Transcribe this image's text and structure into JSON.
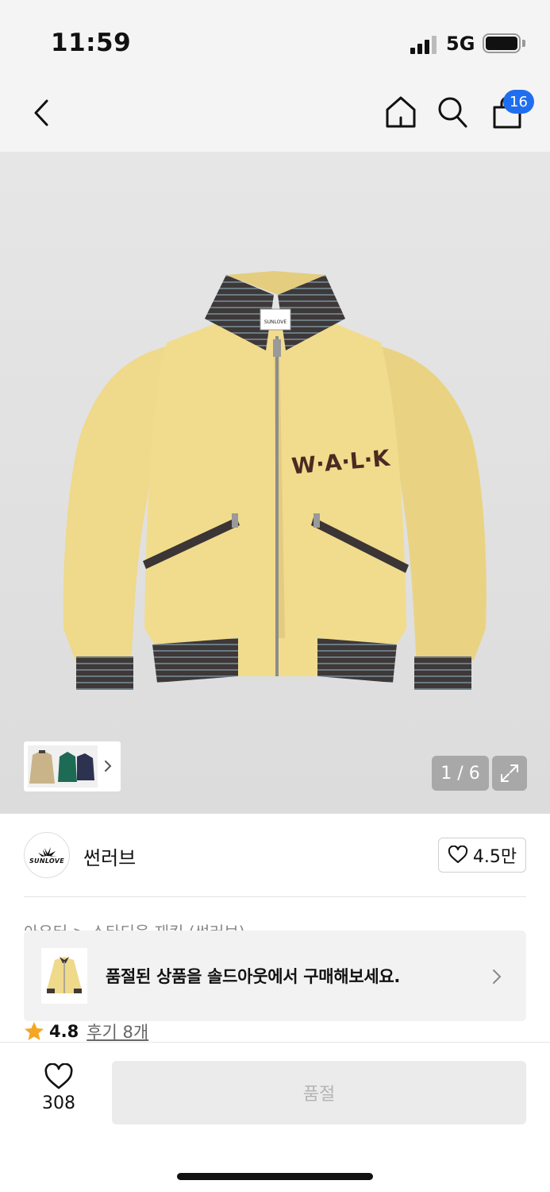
{
  "status_bar": {
    "time": "11:59",
    "network": "5G",
    "icons": [
      "signal-icon",
      "battery-icon"
    ]
  },
  "nav": {
    "icons": [
      "back-arrow-icon",
      "home-icon",
      "search-icon",
      "cart-icon"
    ],
    "cart_badge": "16"
  },
  "gallery": {
    "counter": "1 / 6",
    "icons": [
      "chevron-right-icon",
      "expand-icon"
    ],
    "jacket_text": "W·A·L·K",
    "label_text": "SUNLOVE"
  },
  "brand": {
    "logo_text": "SUNLOVE",
    "name": "썬러브",
    "like_count": "4.5만"
  },
  "breadcrumb": {
    "text": "아우터 > 스타디움 재킷 (썬러브)"
  },
  "soldout_banner": {
    "text": "품절된 상품을 솔드아웃에서 구매해보세요."
  },
  "rating": {
    "score": "4.8",
    "reviews": "후기 8개"
  },
  "bottom_bar": {
    "wish_count": "308",
    "soldout_label": "품절"
  },
  "colors": {
    "badge": "#1f6ef0",
    "jacket": "#efd98a",
    "rib_dark": "#3e3838",
    "rib_stripe": "#6a7a82",
    "star": "#f5a623"
  }
}
